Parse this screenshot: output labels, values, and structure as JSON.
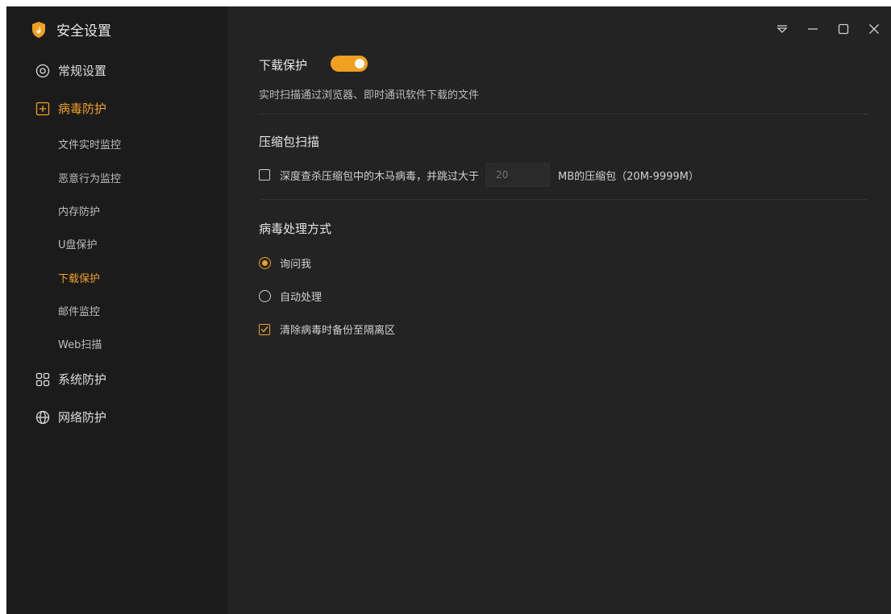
{
  "app": {
    "title": "安全设置",
    "logo_icon": "shield-flame-logo"
  },
  "colors": {
    "accent": "#f0a020",
    "sidebar_bg": "#1b1b1b",
    "main_bg": "#232323"
  },
  "sidebar": {
    "groups": [
      {
        "label": "常规设置",
        "icon": "gear-icon"
      },
      {
        "label": "病毒防护",
        "icon": "plus-square-icon"
      },
      {
        "label": "系统防护",
        "icon": "grid-icon"
      },
      {
        "label": "网络防护",
        "icon": "globe-icon"
      }
    ],
    "virus_items": [
      {
        "label": "文件实时监控"
      },
      {
        "label": "恶意行为监控"
      },
      {
        "label": "内存防护"
      },
      {
        "label": "U盘保护"
      },
      {
        "label": "下载保护"
      },
      {
        "label": "邮件监控"
      },
      {
        "label": "Web扫描"
      }
    ]
  },
  "window_controls": [
    "dropdown-menu-icon",
    "minimize-icon",
    "maximize-icon",
    "close-icon"
  ],
  "main": {
    "download_protection": {
      "title": "下载保护",
      "enabled": true,
      "description": "实时扫描通过浏览器、即时通讯软件下载的文件"
    },
    "archive_scan": {
      "title": "压缩包扫描",
      "checked": false,
      "label_before": "深度查杀压缩包中的木马病毒，并跳过大于",
      "size_placeholder": "20",
      "label_after": "MB的压缩包（20M-9999M）"
    },
    "virus_handling": {
      "title": "病毒处理方式",
      "options": [
        {
          "label": "询问我",
          "selected": true
        },
        {
          "label": "自动处理",
          "selected": false
        }
      ],
      "backup": {
        "label": "清除病毒时备份至隔离区",
        "checked": true
      }
    }
  }
}
